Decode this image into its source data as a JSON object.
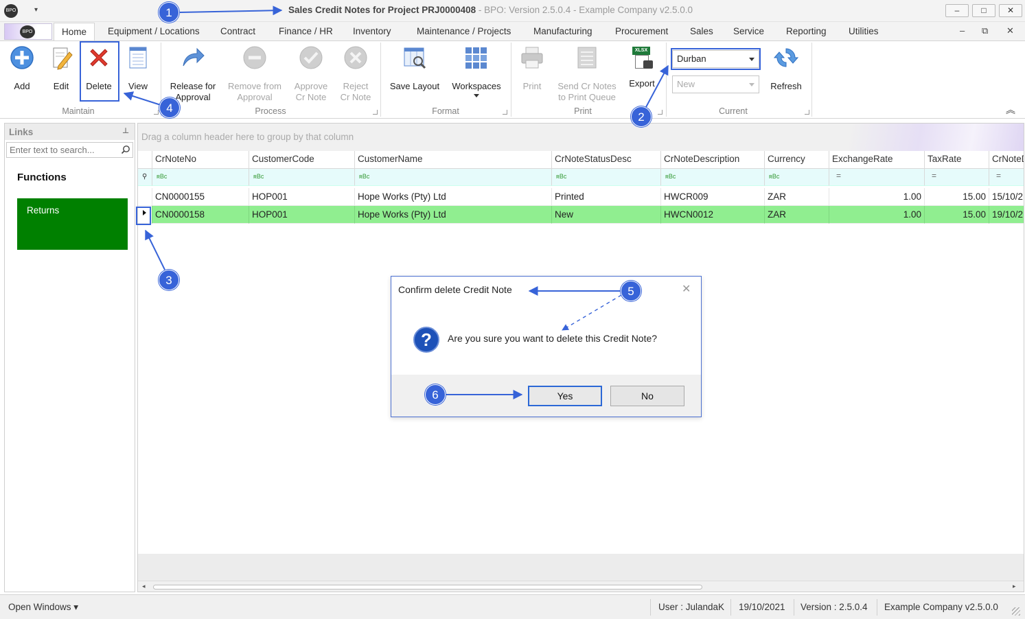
{
  "window": {
    "title": "Sales Credit Notes for Project PRJ0000408",
    "subtitle": " - BPO: Version 2.5.0.4 - Example Company v2.5.0.0",
    "min": "–",
    "max": "□",
    "close": "✕",
    "app_logo": "BPO",
    "qat_arrow": "▾"
  },
  "tabs": {
    "home": "Home",
    "items": [
      "Equipment / Locations",
      "Contract",
      "Finance / HR",
      "Inventory",
      "Maintenance / Projects",
      "Manufacturing",
      "Procurement",
      "Sales",
      "Service",
      "Reporting",
      "Utilities"
    ],
    "mdi_min": "–",
    "mdi_restore": "⧉",
    "mdi_close": "✕"
  },
  "ribbon": {
    "maintain": {
      "label": "Maintain",
      "add": "Add",
      "edit": "Edit",
      "delete": "Delete",
      "view": "View"
    },
    "process": {
      "label": "Process",
      "release_l1": "Release for",
      "release_l2": "Approval",
      "remove_l1": "Remove from",
      "remove_l2": "Approval",
      "approve_l1": "Approve",
      "approve_l2": "Cr Note",
      "reject_l1": "Reject",
      "reject_l2": "Cr Note"
    },
    "format": {
      "label": "Format",
      "save_layout": "Save Layout",
      "workspaces": "Workspaces"
    },
    "print": {
      "label": "Print",
      "print": "Print",
      "send_l1": "Send Cr Notes",
      "send_l2": "to Print Queue",
      "export": "Export",
      "export_badge": "XLSX"
    },
    "current": {
      "label": "Current",
      "site_value": "Durban",
      "status_value": "New",
      "refresh": "Refresh"
    },
    "collapse": "︽"
  },
  "links": {
    "header": "Links",
    "pin": "⊥",
    "search_placeholder": "Enter text to search...",
    "functions_label": "Functions",
    "tile_returns": "Returns"
  },
  "grid": {
    "group_hint": "Drag a column header here to group by that column",
    "columns": [
      "CrNoteNo",
      "CustomerCode",
      "CustomerName",
      "CrNoteStatusDesc",
      "CrNoteDescription",
      "Currency",
      "ExchangeRate",
      "TaxRate",
      "CrNoteD"
    ],
    "filter_text": "ʀBc",
    "filter_eq": "=",
    "rows": [
      {
        "no": "CN0000155",
        "code": "HOP001",
        "name": "Hope Works (Pty) Ltd",
        "status": "Printed",
        "desc": "HWCR009",
        "currency": "ZAR",
        "rate": "1.00",
        "tax": "15.00",
        "date": "15/10/2"
      },
      {
        "no": "CN0000158",
        "code": "HOP001",
        "name": "Hope Works (Pty) Ltd",
        "status": "New",
        "desc": "HWCN0012",
        "currency": "ZAR",
        "rate": "1.00",
        "tax": "15.00",
        "date": "19/10/2"
      }
    ]
  },
  "dialog": {
    "title": "Confirm delete Credit Note",
    "message": "Are you sure you want to delete this Credit Note?",
    "yes": "Yes",
    "no": "No",
    "close": "✕",
    "icon": "?"
  },
  "status": {
    "open_windows": "Open Windows ▾",
    "user": "User : JulandaK",
    "date": "19/10/2021",
    "version": "Version : 2.5.0.4",
    "company": "Example Company v2.5.0.0"
  },
  "callouts": [
    "1",
    "2",
    "3",
    "4",
    "5",
    "6"
  ],
  "colors": {
    "accent": "#3763d8",
    "selected_row": "#90ee90",
    "tile": "#008000",
    "delete_red": "#e03a2e"
  }
}
